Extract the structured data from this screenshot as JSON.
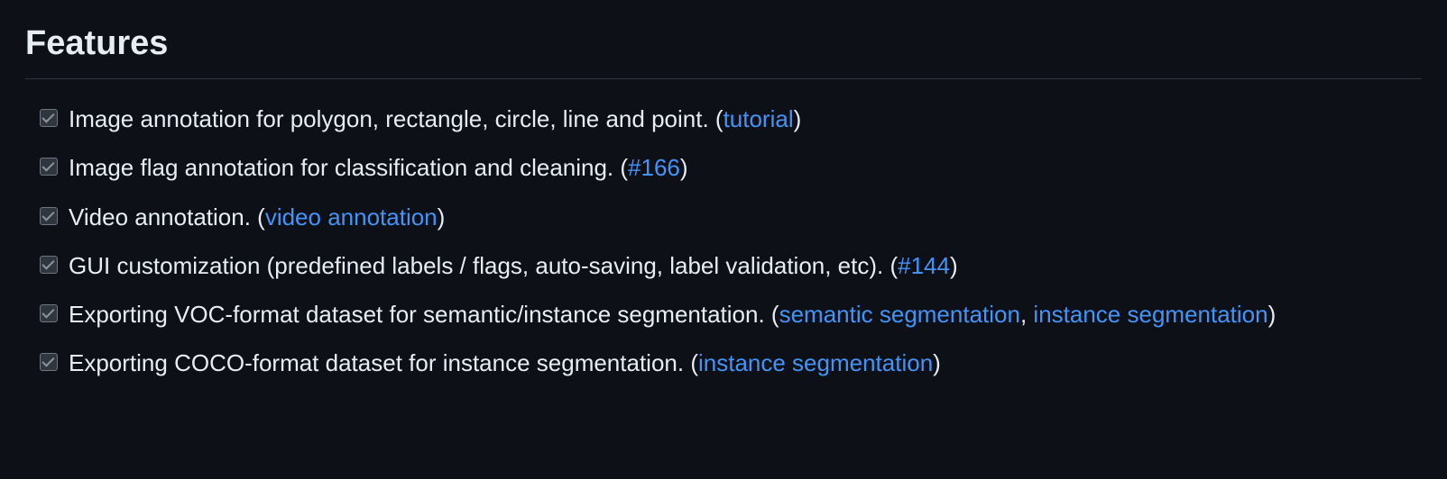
{
  "heading": "Features",
  "items": [
    {
      "checked": true,
      "text_before": "Image annotation for polygon, rectangle, circle, line and point. (",
      "links": [
        {
          "label": "tutorial",
          "after": ")"
        }
      ]
    },
    {
      "checked": true,
      "text_before": "Image flag annotation for classification and cleaning. (",
      "links": [
        {
          "label": "#166",
          "after": ")"
        }
      ]
    },
    {
      "checked": true,
      "text_before": "Video annotation. (",
      "links": [
        {
          "label": "video annotation",
          "after": ")"
        }
      ]
    },
    {
      "checked": true,
      "text_before": "GUI customization (predefined labels / flags, auto-saving, label validation, etc). (",
      "links": [
        {
          "label": "#144",
          "after": ")"
        }
      ]
    },
    {
      "checked": true,
      "text_before": "Exporting VOC-format dataset for semantic/instance segmentation. (",
      "links": [
        {
          "label": "semantic segmentation",
          "after": ", "
        },
        {
          "label": "instance segmentation",
          "after": ")"
        }
      ]
    },
    {
      "checked": true,
      "text_before": "Exporting COCO-format dataset for instance segmentation. (",
      "links": [
        {
          "label": "instance segmentation",
          "after": ")"
        }
      ]
    }
  ]
}
